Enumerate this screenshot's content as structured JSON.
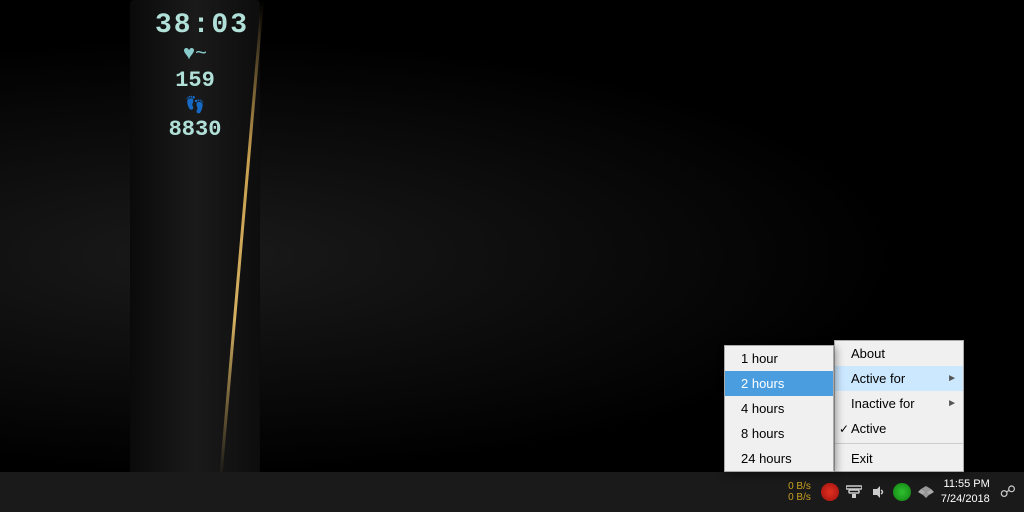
{
  "background": {
    "color": "#000000"
  },
  "device": {
    "time": "38:03",
    "heart_icon": "♥~",
    "bpm": "159",
    "steps_icon": "👣",
    "steps": "8830"
  },
  "taskbar": {
    "network_up": "0 B/s",
    "network_down": "0 B/s",
    "time": "11:55 PM",
    "date": "7/24/2018"
  },
  "context_menu_main": {
    "items": [
      {
        "label": "About",
        "has_check": false,
        "has_arrow": false,
        "highlighted": false,
        "id": "about"
      },
      {
        "label": "Active for",
        "has_check": false,
        "has_arrow": true,
        "highlighted": false,
        "id": "active-for"
      },
      {
        "label": "Inactive for",
        "has_check": false,
        "has_arrow": true,
        "highlighted": false,
        "id": "inactive-for"
      },
      {
        "label": "Active",
        "has_check": true,
        "has_arrow": false,
        "highlighted": false,
        "id": "active"
      },
      {
        "label": "Exit",
        "has_check": false,
        "has_arrow": false,
        "highlighted": false,
        "id": "exit"
      }
    ]
  },
  "context_menu_hours": {
    "items": [
      {
        "label": "1 hour",
        "selected": false,
        "id": "1hour"
      },
      {
        "label": "2 hours",
        "selected": true,
        "id": "2hours"
      },
      {
        "label": "4 hours",
        "selected": false,
        "id": "4hours"
      },
      {
        "label": "8 hours",
        "selected": false,
        "id": "8hours"
      },
      {
        "label": "24 hours",
        "selected": false,
        "id": "24hours"
      }
    ]
  }
}
